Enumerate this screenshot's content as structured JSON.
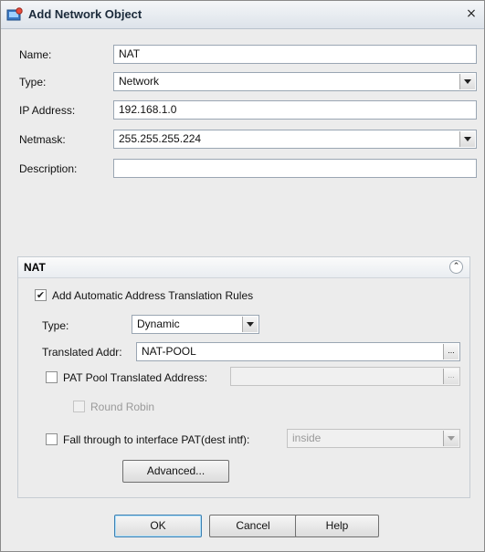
{
  "window": {
    "title": "Add Network Object",
    "close": "×"
  },
  "form": {
    "name_label": "Name:",
    "name_value": "NAT",
    "type_label": "Type:",
    "type_value": "Network",
    "ip_label": "IP Address:",
    "ip_value": "192.168.1.0",
    "netmask_label": "Netmask:",
    "netmask_value": "255.255.255.224",
    "description_label": "Description:",
    "description_value": ""
  },
  "nat": {
    "title": "NAT",
    "collapse_glyph": "⌃",
    "auto_rules_label": "Add Automatic Address Translation Rules",
    "auto_rules_checked": "✔",
    "type_label": "Type:",
    "type_value": "Dynamic",
    "translated_label": "Translated Addr:",
    "translated_value": "NAT-POOL",
    "browse_glyph": "...",
    "pat_pool_label": "PAT Pool Translated Address:",
    "pat_pool_value": "",
    "round_robin_label": "Round Robin",
    "fall_through_label": "Fall through to interface PAT(dest intf):",
    "fall_through_value": "inside",
    "advanced_label": "Advanced..."
  },
  "buttons": {
    "ok": "OK",
    "cancel": "Cancel",
    "help": "Help"
  }
}
